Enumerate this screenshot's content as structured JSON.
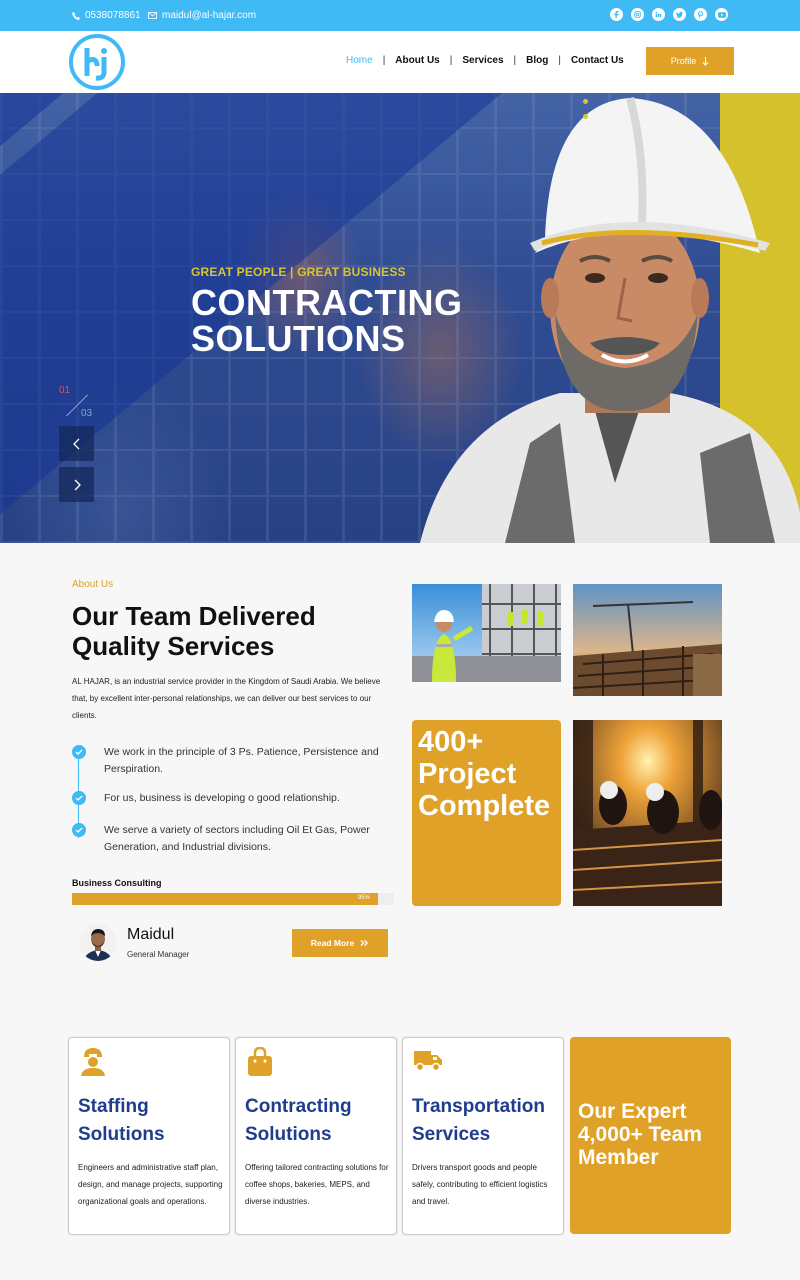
{
  "topbar": {
    "phone": "0538078861",
    "email": "maidul@al-hajar.com",
    "socials": [
      "facebook-icon",
      "instagram-icon",
      "linkedin-icon",
      "twitter-icon",
      "pinterest-icon",
      "youtube-icon"
    ]
  },
  "header": {
    "logo_letters": "hj",
    "nav": [
      {
        "label": "Home",
        "active": true
      },
      {
        "label": "About Us"
      },
      {
        "label": "Services"
      },
      {
        "label": "Blog"
      },
      {
        "label": "Contact Us"
      }
    ],
    "nav_separator": "|",
    "profile_button": "Profile"
  },
  "hero": {
    "eyebrow": "GREAT PEOPLE | GREAT BUSINESS",
    "title": "CONTRACTING SOLUTIONS",
    "slide_current": "01",
    "slide_total": "03"
  },
  "about": {
    "kicker": "About Us",
    "title": "Our Team Delivered Quality Services",
    "description": "AL HAJAR, is an industrial service provider in the Kingdom of Saudi Arabia. We believe that, by excellent inter-personal relationships, we can deliver our best services to our clients.",
    "points": [
      "We work in the principle of 3 Ps. Patience, Persistence and Perspiration.",
      "For us, business is developing o good relationship.",
      "We serve a variety of sectors including Oil Et Gas, Power Generation, and Industrial divisions."
    ],
    "skill": {
      "label": "Business Consulting",
      "percent_text": "95%",
      "percent": 95
    },
    "person": {
      "name": "Maidul",
      "role": "General Manager"
    },
    "read_more": "Read More",
    "stat": "400+ Project Complete"
  },
  "services": [
    {
      "title": "Staffing Solutions",
      "text": "Engineers and administrative staff plan, design, and manage projects, supporting organizational goals and operations.",
      "icon": "worker-icon"
    },
    {
      "title": "Contracting Solutions",
      "text": "Offering tailored contracting solutions for coffee shops, bakeries, MEPS, and diverse industries.",
      "icon": "bag-icon"
    },
    {
      "title": "Transportation Services",
      "text": "Drivers transport goods and people safely, contributing to efficient logistics and travel.",
      "icon": "truck-icon"
    }
  ],
  "team_card": "Our Expert 4,000+ Team Member",
  "colors": {
    "accent": "#e0a128",
    "primary": "#3fbaf5",
    "heading_blue": "#1f3d8c"
  }
}
